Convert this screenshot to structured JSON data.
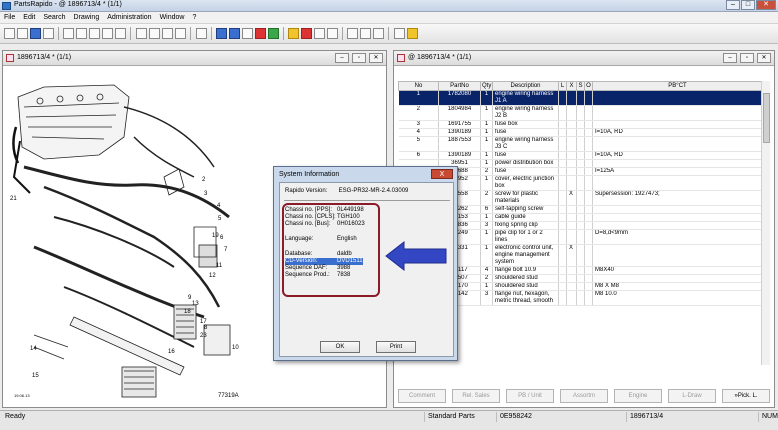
{
  "app": {
    "title": "PartsRapido - @ 1896713/4 * (1/1)"
  },
  "menu": [
    "File",
    "Edit",
    "Search",
    "Drawing",
    "Administration",
    "Window",
    "?"
  ],
  "left_pane": {
    "title": "1896713/4 * (1/1)",
    "callouts": [
      "2",
      "3",
      "4",
      "5",
      "6",
      "7",
      "8",
      "9",
      "10",
      "11",
      "12",
      "13",
      "14",
      "15",
      "16",
      "17",
      "18",
      "19",
      "21",
      "23"
    ],
    "drawing_code": "77319A",
    "date_label": "19.06.13"
  },
  "right_pane": {
    "title": "@ 1896713/4 * (1/1)",
    "columns": [
      "No",
      "PartNo",
      "Qty",
      "Description",
      "L",
      "X",
      "S",
      "O",
      "PB°CT"
    ],
    "rows": [
      {
        "no": "1",
        "part": "1782080",
        "qty": "1",
        "desc": "engine wiring harness J1 A",
        "x": "",
        "pbct": "",
        "selected": true
      },
      {
        "no": "2",
        "part": "1804984",
        "qty": "1",
        "desc": "engine wiring harness J2 B",
        "x": "",
        "pbct": "",
        "selected": false
      },
      {
        "no": "3",
        "part": "1691755",
        "qty": "1",
        "desc": "fuse box",
        "x": "",
        "pbct": "",
        "selected": false
      },
      {
        "no": "4",
        "part": "1390189",
        "qty": "1",
        "desc": "fuse",
        "x": "",
        "pbct": "I=10A, RD",
        "selected": false
      },
      {
        "no": "5",
        "part": "1887553",
        "qty": "1",
        "desc": "engine wiring harness J3 C",
        "x": "",
        "pbct": "",
        "selected": false
      },
      {
        "no": "6",
        "part": "1390189",
        "qty": "1",
        "desc": "fuse",
        "x": "",
        "pbct": "I=10A, RD",
        "selected": false
      },
      {
        "no": "",
        "part": "36951",
        "qty": "1",
        "desc": "power distribution box",
        "x": "",
        "pbct": "",
        "selected": false
      },
      {
        "no": "",
        "part": "76688",
        "qty": "2",
        "desc": "fuse",
        "x": "",
        "pbct": "I=125A",
        "selected": false
      },
      {
        "no": "",
        "part": "80952",
        "qty": "1",
        "desc": "cover, electric junction box",
        "x": "",
        "pbct": "",
        "selected": false
      },
      {
        "no": "",
        "part": "26558",
        "qty": "2",
        "desc": "screw for plastic materials",
        "x": "X",
        "pbct": "Supersession: 1927473;",
        "selected": false
      },
      {
        "no": "",
        "part": "43262",
        "qty": "6",
        "desc": "self-tapping screw",
        "x": "",
        "pbct": "",
        "selected": false
      },
      {
        "no": "",
        "part": "62153",
        "qty": "1",
        "desc": "cable guide",
        "x": "",
        "pbct": "",
        "selected": false
      },
      {
        "no": "",
        "part": "25836",
        "qty": "3",
        "desc": "fixing spring clip",
        "x": "",
        "pbct": "",
        "selected": false
      },
      {
        "no": "",
        "part": "33249",
        "qty": "1",
        "desc": "pipe clip for 1 or 2 lines",
        "x": "",
        "pbct": "D=8,d<9mm",
        "selected": false
      },
      {
        "no": "",
        "part": "87331",
        "qty": "1",
        "desc": "electronic control unit, engine management system",
        "x": "X",
        "pbct": "",
        "selected": false
      },
      {
        "no": "",
        "part": "13117",
        "qty": "4",
        "desc": "flange bolt 10.9",
        "x": "",
        "pbct": "M8X40",
        "selected": false
      },
      {
        "no": "",
        "part": "97507",
        "qty": "2",
        "desc": "shouldered stud",
        "x": "",
        "pbct": "",
        "selected": false
      },
      {
        "no": "",
        "part": "30170",
        "qty": "1",
        "desc": "shouldered stud",
        "x": "",
        "pbct": "M8 X M8",
        "selected": false
      },
      {
        "no": "",
        "part": "13142",
        "qty": "3",
        "desc": "flange nut, hexagon, metric thread, smooth",
        "x": "",
        "pbct": "M8 10.0",
        "selected": false
      }
    ],
    "bottom_buttons": [
      "Comment",
      "Rel. Sales",
      "PB / Unit",
      "Assortm",
      "Engine",
      "L-Draw",
      "»Pick. L."
    ]
  },
  "dialog": {
    "title": "System Information",
    "close": "X",
    "rapido_version_label": "Rapido Version:",
    "rapido_version": "ESG-PR32-MR-2.4.03009",
    "rows": [
      {
        "k": "Chassi no. [PPS]:",
        "v": "0L449198"
      },
      {
        "k": "Chassi no. [CPLS]:",
        "v": "TGH100"
      },
      {
        "k": "Chassi no. [Bus]:",
        "v": "0H016023"
      },
      {
        "k": "Language:",
        "v": "English"
      },
      {
        "k": "Database:",
        "v": "daldb"
      },
      {
        "k": "CD-Version:",
        "v": "DVD1511"
      },
      {
        "k": "Sequence DAF:",
        "v": "3988"
      },
      {
        "k": "Sequence Prod.:",
        "v": "7838"
      }
    ],
    "ok": "OK",
    "print": "Print"
  },
  "status": {
    "ready": "Ready",
    "mode": "Standard Parts",
    "code": "0E958242",
    "doc": "1896713/4",
    "num": "NUM"
  },
  "colors": {
    "arrow": "#3346c4",
    "redbox": "#8b1a2a",
    "selection": "#0a246a"
  },
  "icons": [
    "app-icon",
    "new-icon",
    "open-icon",
    "save-icon",
    "print-icon",
    "zoom-in-icon",
    "zoom-out-icon",
    "first-icon",
    "prev-icon",
    "next-icon",
    "last-icon",
    "binoculars-icon",
    "filter-icon",
    "star-icon",
    "help-icon"
  ]
}
